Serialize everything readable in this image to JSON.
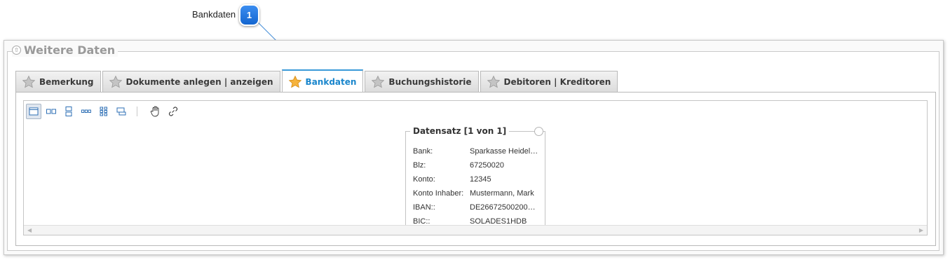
{
  "callout": {
    "label": "Bankdaten",
    "number": "1"
  },
  "group": {
    "title": "Weitere Daten"
  },
  "tabs": [
    {
      "label": "Bemerkung",
      "active": false
    },
    {
      "label": "Dokumente anlegen | anzeigen",
      "active": false
    },
    {
      "label": "Bankdaten",
      "active": true
    },
    {
      "label": "Buchungshistorie",
      "active": false
    },
    {
      "label": "Debitoren | Kreditoren",
      "active": false
    }
  ],
  "toolbar": {
    "buttons": [
      "single-view-icon",
      "two-columns-icon",
      "two-rows-icon",
      "multi-columns-icon",
      "multi-rows-icon",
      "card-view-icon",
      "pan-hand-icon",
      "link-icon"
    ]
  },
  "record": {
    "title": "Datensatz [1 von 1]",
    "fields": [
      {
        "label": "Bank:",
        "value": "Sparkasse Heidel…"
      },
      {
        "label": "Blz:",
        "value": "67250020"
      },
      {
        "label": "Konto:",
        "value": "12345"
      },
      {
        "label": "Konto Inhaber:",
        "value": "Mustermann, Mark"
      },
      {
        "label": "IBAN::",
        "value": "DE26672500200…"
      },
      {
        "label": "BIC::",
        "value": "SOLADES1HDB"
      }
    ]
  },
  "colors": {
    "accent": "#1a86cc",
    "badge": "#1466d0",
    "star_active": "#f5a623",
    "star_inactive": "#b5b5b5"
  }
}
